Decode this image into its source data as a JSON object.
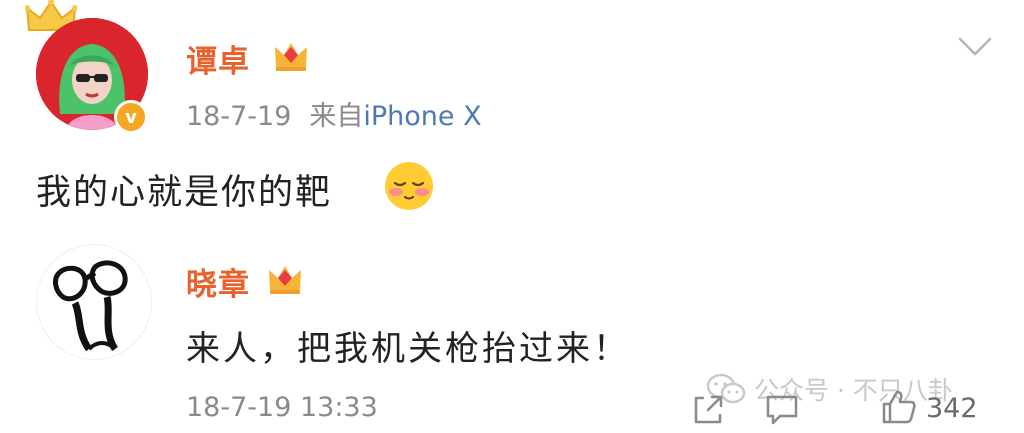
{
  "post": {
    "author": "谭卓",
    "date": "18-7-19",
    "source_prefix": "来自",
    "source": "iPhone X",
    "text": "我的心就是你的靶",
    "emoji": "shy-face-emoji"
  },
  "comment": {
    "author": "晓章",
    "text": "来人，把我机关枪抬过来！",
    "time": "18-7-19 13:33",
    "likes": "342"
  },
  "watermark": {
    "text": "公众号 · 不只八卦"
  },
  "icons": {
    "crown": "crown-icon",
    "verified": "verified-v-icon",
    "vip": "vip-crown-badge-icon",
    "chevron": "chevron-down-icon",
    "share": "share-icon",
    "comment": "comment-icon",
    "like": "thumbs-up-icon",
    "wechat": "wechat-icon"
  },
  "colors": {
    "name": "#e8622c",
    "source_link": "#4e79b5",
    "meta": "#8a8a8a",
    "verified_badge": "#f5a623",
    "avatar_bg": "#d9262c"
  }
}
